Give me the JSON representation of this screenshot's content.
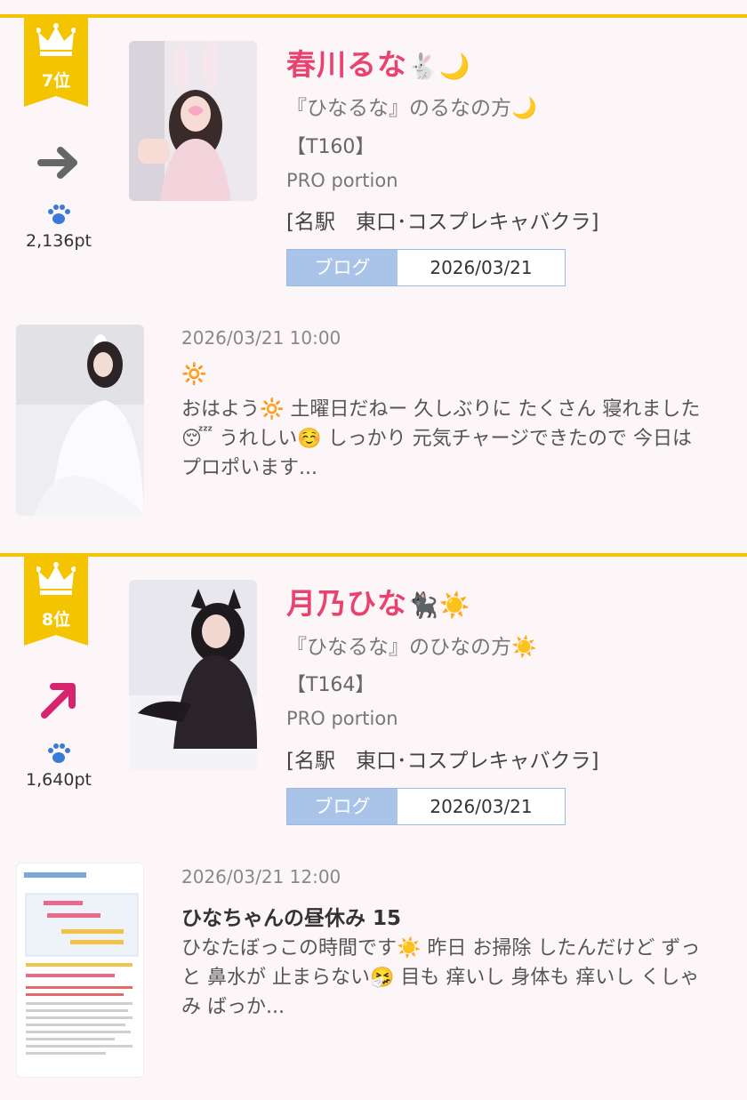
{
  "entries": [
    {
      "rank": "7位",
      "trend": "flat",
      "trend_icon": "right-arrow-icon",
      "points": "2,136pt",
      "name": "春川るな",
      "name_emoji": "🐇🌙",
      "tagline": "『ひなるな』のるなの方🌙",
      "height": "【T160】",
      "shop": "PRO portion",
      "area": "[名駅　東口･コスプレキャバクラ]",
      "blog_label": "ブログ",
      "blog_date": "2026/03/21",
      "post": {
        "time": "2026/03/21 10:00",
        "title": "🔆",
        "body": "おはよう🔆 土曜日だねー 久しぶりに たくさん 寝れました😴 うれしい☺️ しっかり 元気チャージできたので 今日は プロポいます..."
      }
    },
    {
      "rank": "8位",
      "trend": "up",
      "trend_icon": "up-right-arrow-icon",
      "points": "1,640pt",
      "name": "月乃ひな",
      "name_emoji": "🐈‍⬛☀️",
      "tagline": "『ひなるな』のひなの方☀️",
      "height": "【T164】",
      "shop": "PRO portion",
      "area": "[名駅　東口･コスプレキャバクラ]",
      "blog_label": "ブログ",
      "blog_date": "2026/03/21",
      "post": {
        "time": "2026/03/21 12:00",
        "title": "ひなちゃんの昼休み 15",
        "body": "ひなたぼっこの時間です☀️ 昨日 お掃除 したんだけど ずっと 鼻水が 止まらない🤧 目も 痒いし 身体も 痒いし くしゃみ ばっか..."
      }
    }
  ],
  "colors": {
    "accent_yellow": "#f5c400",
    "name_pink": "#e8436f",
    "arrow_flat": "#666666",
    "arrow_up": "#d6246e",
    "blog_label_bg": "#a9c4e8"
  }
}
